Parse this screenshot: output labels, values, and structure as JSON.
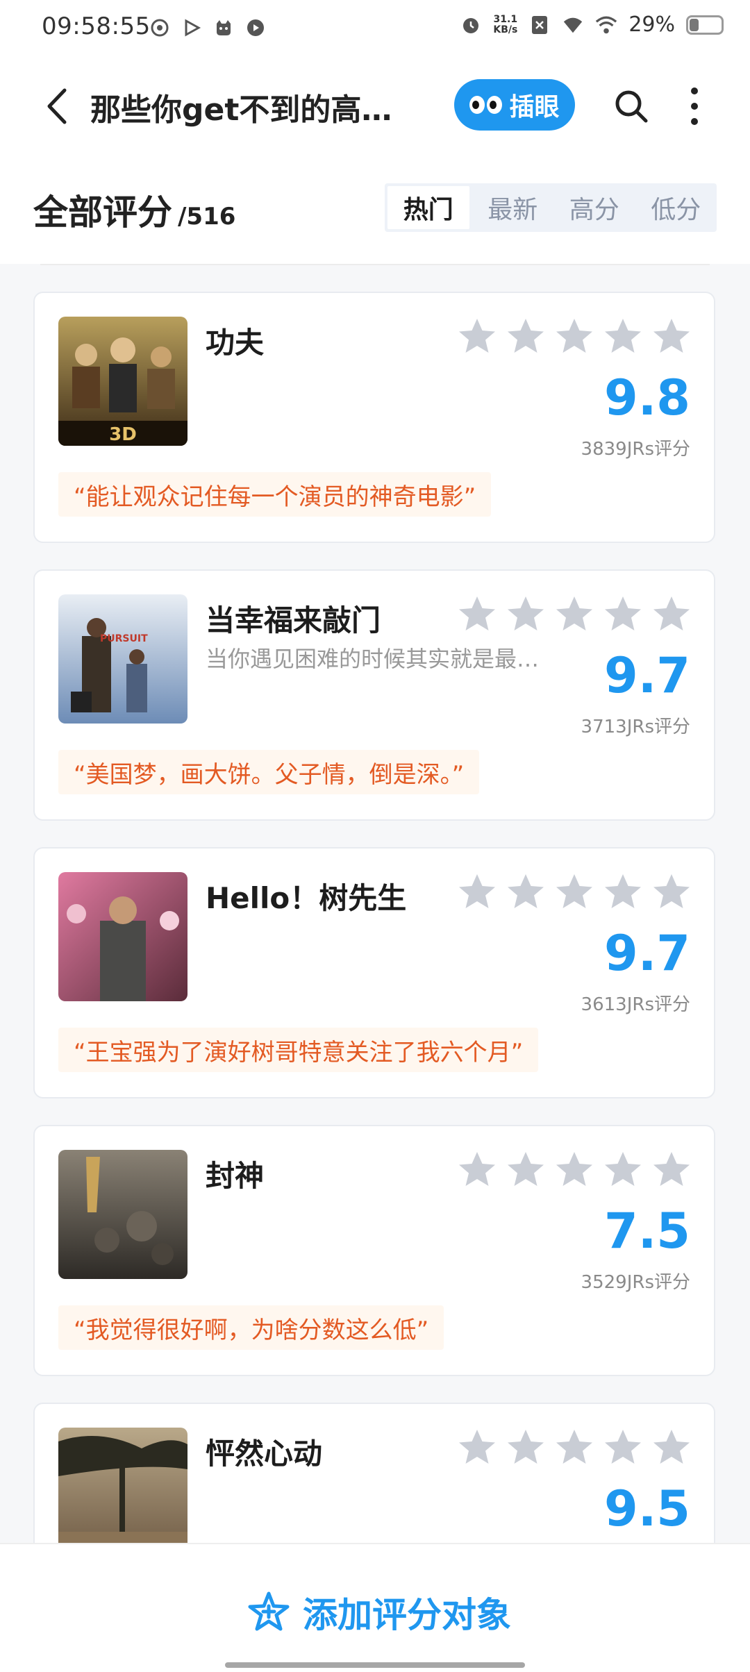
{
  "status_bar": {
    "time": "09:58:55",
    "net_speed_value": "31.1",
    "net_speed_unit": "KB/s",
    "battery_percent": "29%",
    "battery_level": 0.29
  },
  "header": {
    "title": "那些你get不到的高…",
    "peek_label": "插眼"
  },
  "section": {
    "title": "全部评分",
    "count": "/516",
    "sort_tabs": [
      "热门",
      "最新",
      "高分",
      "低分"
    ],
    "active_tab": "热门"
  },
  "items": [
    {
      "name": "功夫",
      "desc": "",
      "score": "9.8",
      "raters": "3839JRs评分",
      "quote": "“能让观众记住每一个演员的神奇电影”"
    },
    {
      "name": "当幸福来敲门",
      "desc": "当你遇见困难的时候其实就是最…",
      "score": "9.7",
      "raters": "3713JRs评分",
      "quote": "“美国梦，画大饼。父子情，倒是深。”"
    },
    {
      "name": "Hello！树先生",
      "desc": "",
      "score": "9.7",
      "raters": "3613JRs评分",
      "quote": "“王宝强为了演好树哥特意关注了我六个月”"
    },
    {
      "name": "封神",
      "desc": "",
      "score": "7.5",
      "raters": "3529JRs评分",
      "quote": "“我觉得很好啊，为啥分数这么低”"
    },
    {
      "name": "怦然心动",
      "desc": "",
      "score": "9.5",
      "raters": "",
      "quote": ""
    }
  ],
  "bottom": {
    "add_label": "添加评分对象"
  },
  "colors": {
    "accent": "#1f97ef",
    "quote_text": "#e35a23",
    "quote_bg": "#fff7ef",
    "star_gray": "#c9cdd5"
  }
}
